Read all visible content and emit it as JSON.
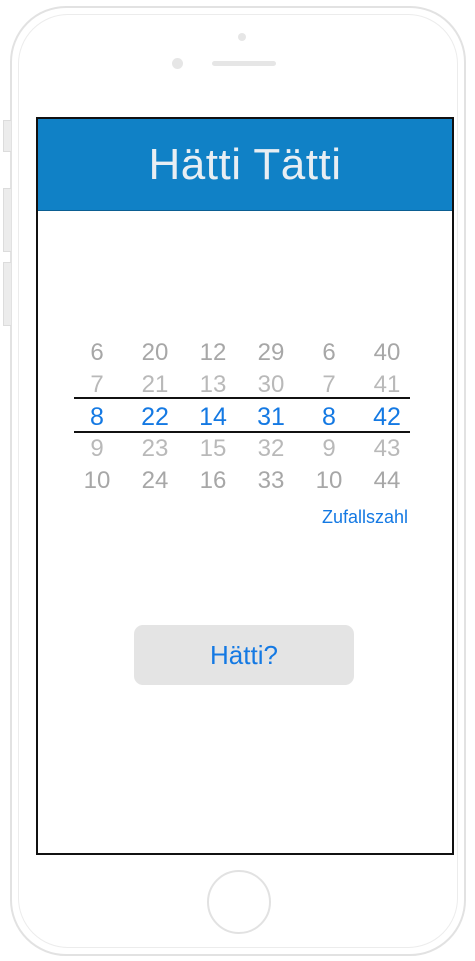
{
  "app": {
    "title": "Hätti Tätti"
  },
  "picker": {
    "columns": [
      {
        "values": [
          "6",
          "7",
          "8",
          "9",
          "10"
        ],
        "selected": "8"
      },
      {
        "values": [
          "20",
          "21",
          "22",
          "23",
          "24"
        ],
        "selected": "22"
      },
      {
        "values": [
          "12",
          "13",
          "14",
          "15",
          "16"
        ],
        "selected": "14"
      },
      {
        "values": [
          "29",
          "30",
          "31",
          "32",
          "33"
        ],
        "selected": "31"
      },
      {
        "values": [
          "6",
          "7",
          "8",
          "9",
          "10"
        ],
        "selected": "8"
      },
      {
        "values": [
          "40",
          "41",
          "42",
          "43",
          "44"
        ],
        "selected": "42"
      }
    ]
  },
  "random_button": {
    "label": "Zufallszahl"
  },
  "action_button": {
    "label": "Hätti?"
  },
  "colors": {
    "navbar": "#1081c6",
    "accent": "#1479e3",
    "inactive_number": "#a7a7a7",
    "button_bg": "#e4e4e4"
  }
}
